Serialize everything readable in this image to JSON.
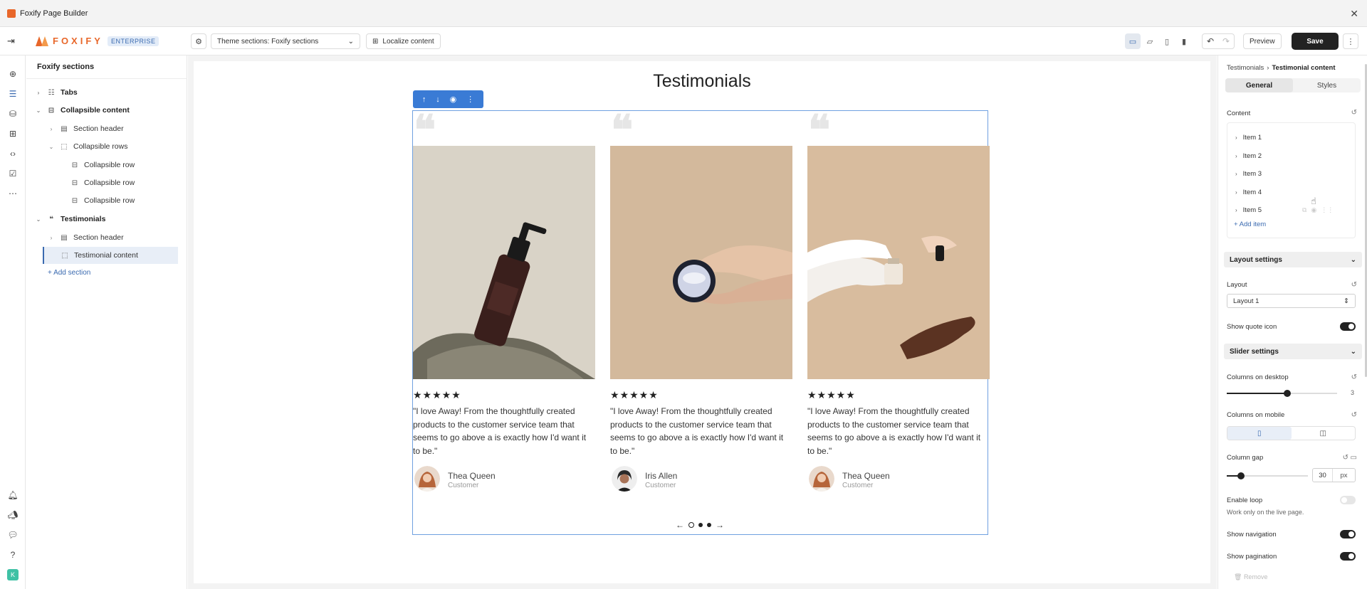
{
  "window": {
    "title": "Foxify Page Builder"
  },
  "topbar": {
    "logo_word": "FOXIFY",
    "logo_badge": "ENTERPRISE",
    "theme_select": "Theme sections: Foxify sections",
    "localize_label": "Localize content",
    "preview_label": "Preview",
    "save_label": "Save"
  },
  "left_panel": {
    "title": "Foxify sections",
    "tree": [
      {
        "label": "Tabs"
      },
      {
        "label": "Collapsible content"
      },
      {
        "label": "Section header"
      },
      {
        "label": "Collapsible rows"
      },
      {
        "label": "Collapsible row"
      },
      {
        "label": "Collapsible row"
      },
      {
        "label": "Collapsible row"
      },
      {
        "label": "Testimonials"
      },
      {
        "label": "Section header"
      },
      {
        "label": "Testimonial content"
      }
    ],
    "add_section": "Add section"
  },
  "canvas": {
    "heading": "Testimonials",
    "cards": [
      {
        "stars": "★★★★★",
        "text": "\"I love Away! From the thoughtfully created products to the customer service team that seems to go above a is exactly how I'd want it to be.\"",
        "name": "Thea Queen",
        "role": "Customer"
      },
      {
        "stars": "★★★★★",
        "text": "\"I love Away! From the thoughtfully created products to the customer service team that seems to go above a is exactly how I'd want it to be.\"",
        "name": "Iris Allen",
        "role": "Customer"
      },
      {
        "stars": "★★★★★",
        "text": "\"I love Away! From the thoughtfully created products to the customer service team that seems to go above a is exactly how I'd want it to be.\"",
        "name": "Thea Queen",
        "role": "Customer"
      }
    ],
    "pagination": {
      "count": 3,
      "active": 1
    }
  },
  "right_panel": {
    "breadcrumb": {
      "parent": "Testimonials",
      "current": "Testimonial content"
    },
    "tabs": {
      "general": "General",
      "styles": "Styles"
    },
    "content_label": "Content",
    "items": [
      "Item 1",
      "Item 2",
      "Item 3",
      "Item 4",
      "Item 5"
    ],
    "add_item": "Add item",
    "layout_settings": "Layout settings",
    "layout_label": "Layout",
    "layout_value": "Layout 1",
    "show_quote_icon": "Show quote icon",
    "slider_settings": "Slider settings",
    "columns_desktop": "Columns on desktop",
    "columns_desktop_value": "3",
    "columns_mobile": "Columns on mobile",
    "column_gap": "Column gap",
    "column_gap_value": "30",
    "column_gap_unit": "px",
    "enable_loop": "Enable loop",
    "loop_hint": "Work only on the live page.",
    "show_navigation": "Show navigation",
    "show_pagination": "Show pagination",
    "remove": "Remove"
  },
  "colors": {
    "accent": "#3a7bd5",
    "brand": "#e8672a",
    "dark": "#222222"
  }
}
